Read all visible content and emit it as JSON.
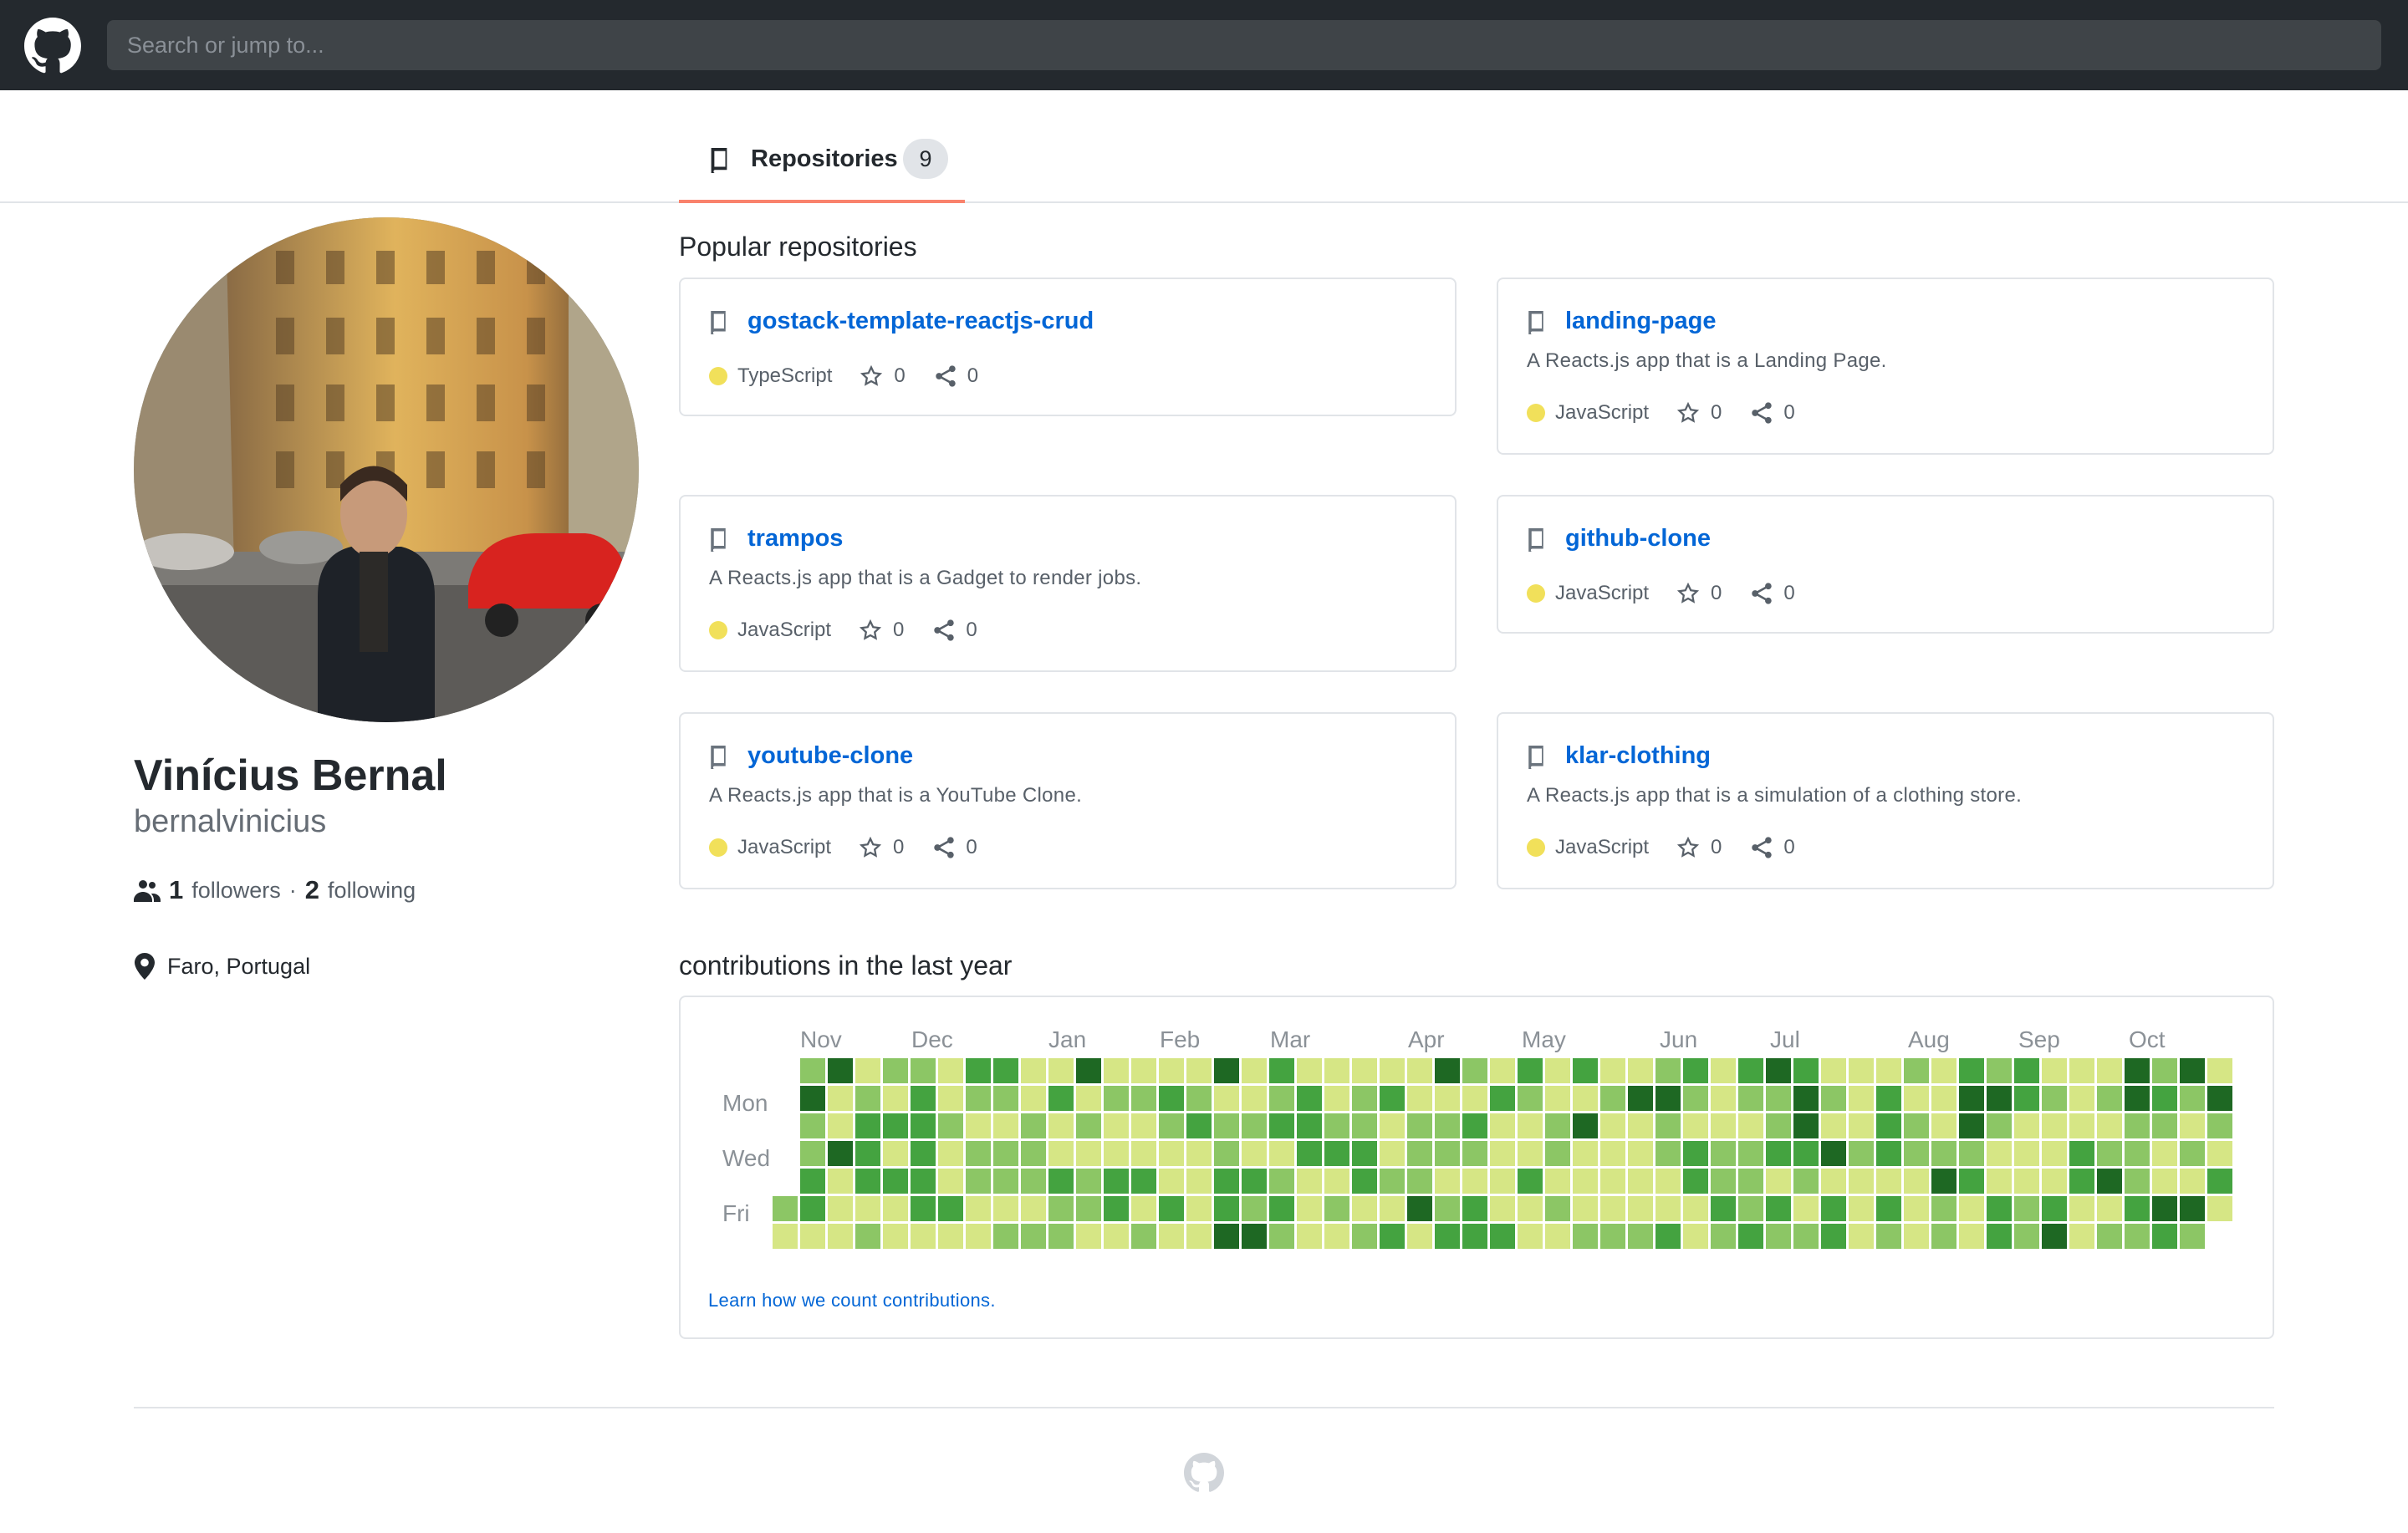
{
  "header": {
    "logo_icon": "github-mark-icon",
    "search_placeholder": "Search or jump to..."
  },
  "tabs": [
    {
      "label": "Repositories",
      "count": "9",
      "icon": "repo-book-icon",
      "active": true
    }
  ],
  "profile": {
    "name": "Vinícius Bernal",
    "login": "bernalvinicius",
    "followers_count": "1",
    "followers_label": "followers",
    "separator": "·",
    "following_count": "2",
    "following_label": "following",
    "location": "Faro, Portugal"
  },
  "popular": {
    "title": "Popular repositories",
    "repos": [
      {
        "name": "gostack-template-reactjs-crud",
        "description": "",
        "language": "TypeScript",
        "stars": "0",
        "forks": "0"
      },
      {
        "name": "landing-page",
        "description": "A Reacts.js app that is a Landing Page.",
        "language": "JavaScript",
        "stars": "0",
        "forks": "0"
      },
      {
        "name": "trampos",
        "description": "A Reacts.js app that is a Gadget to render jobs.",
        "language": "JavaScript",
        "stars": "0",
        "forks": "0"
      },
      {
        "name": "github-clone",
        "description": "",
        "language": "JavaScript",
        "stars": "0",
        "forks": "0"
      },
      {
        "name": "youtube-clone",
        "description": "A Reacts.js app that is a YouTube Clone.",
        "language": "JavaScript",
        "stars": "0",
        "forks": "0"
      },
      {
        "name": "klar-clothing",
        "description": "A Reacts.js app that is a simulation of a clothing store.",
        "language": "JavaScript",
        "stars": "0",
        "forks": "0"
      }
    ]
  },
  "contributions": {
    "title": "contributions in the last year",
    "months": [
      "Nov",
      "Dec",
      "Jan",
      "Feb",
      "Mar",
      "Apr",
      "May",
      "Jun",
      "Jul",
      "Aug",
      "Sep",
      "Oct"
    ],
    "weekday_labels": [
      "Mon",
      "Wed",
      "Fri"
    ],
    "learn_link": "Learn how we count contributions.",
    "colors": [
      "#d6e685",
      "#8cc665",
      "#44a340",
      "#1e6823"
    ]
  },
  "colors": {
    "header_bg": "#24292e",
    "link": "#0366d6",
    "tab_underline": "#f9826c",
    "javascript": "#f1e05a"
  }
}
